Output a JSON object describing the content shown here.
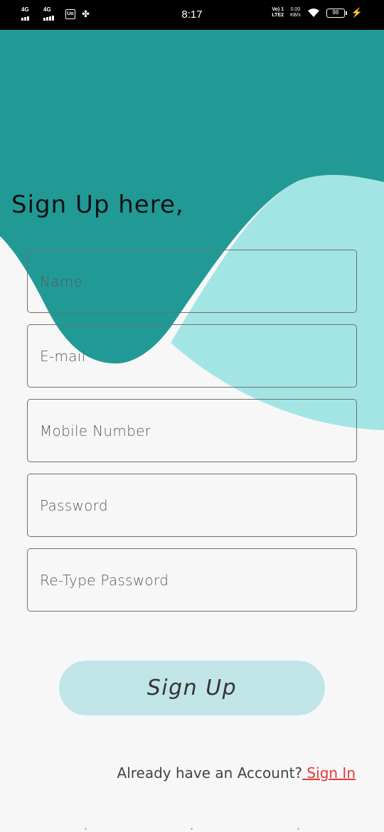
{
  "status_bar": {
    "network_1": "4G",
    "network_2": "4G",
    "time": "8:17",
    "volte": "Vo) 1",
    "lte": "LTE2",
    "speed_value": "0.00",
    "speed_unit": "KB/s",
    "battery": "98",
    "badge": "Uo"
  },
  "form": {
    "heading": "Sign Up here,",
    "name_placeholder": "Name",
    "email_placeholder": "E-mail",
    "mobile_placeholder": "Mobile Number",
    "password_placeholder": "Password",
    "retype_placeholder": "Re-Type Password",
    "submit_label": "Sign Up"
  },
  "footer": {
    "prompt": "Already have an Account?",
    "link": " Sign In"
  },
  "colors": {
    "dark_teal": "#219a96",
    "light_teal": "#a3e5e4",
    "button": "#c1e5e6",
    "link": "#e53935"
  }
}
